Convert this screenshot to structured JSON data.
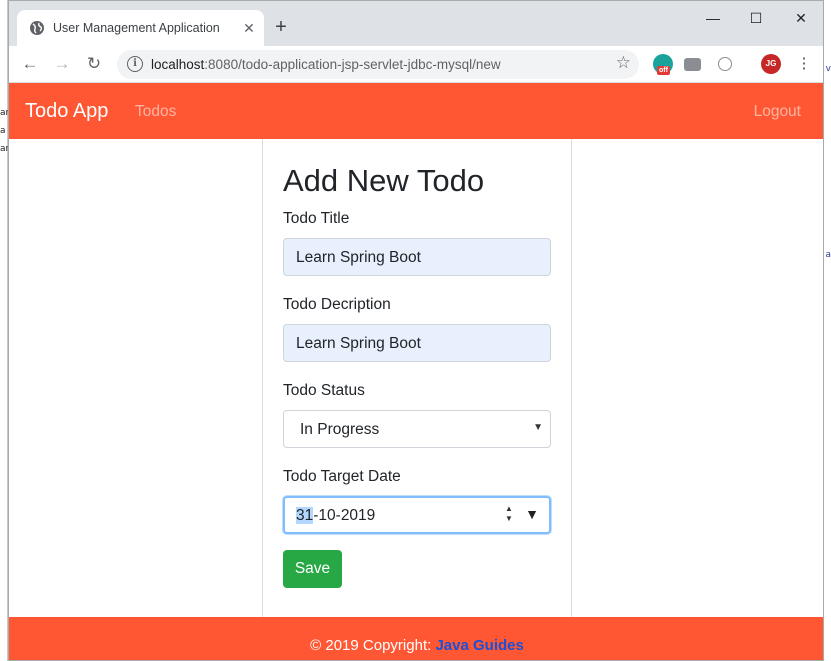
{
  "browser": {
    "tab_title": "User Management Application",
    "new_tab_symbol": "+",
    "url_host": "localhost",
    "url_rest": ":8080/todo-application-jsp-servlet-jdbc-mysql/new",
    "extension_badge": "off",
    "profile_initials": "JG"
  },
  "nav": {
    "brand": "Todo App",
    "todos_link": "Todos",
    "logout_link": "Logout"
  },
  "form": {
    "heading": "Add New Todo",
    "title_label": "Todo Title",
    "title_value": "Learn Spring Boot",
    "description_label": "Todo Decription",
    "description_value": "Learn Spring Boot",
    "status_label": "Todo Status",
    "status_value": "In Progress",
    "date_label": "Todo Target Date",
    "date_day": "31",
    "date_rest": "-10-2019",
    "save_label": "Save"
  },
  "footer": {
    "copyright": "© 2019 Copyright: ",
    "link_text": "Java Guides"
  },
  "colors": {
    "brand": "#ff5733",
    "save": "#28a745",
    "footer_link": "#1a4fd6"
  }
}
